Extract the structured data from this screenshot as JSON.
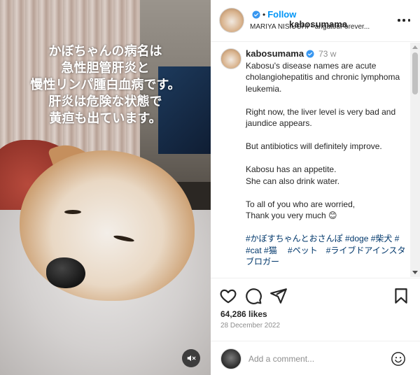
{
  "media": {
    "overlay_lines": [
      "かぼちゃんの病名は",
      "急性胆管肝炎と",
      "慢性リンパ腫白血病です。",
      "肝炎は危険な状態で",
      "黄疸も出ています。"
    ],
    "mute_icon": "speaker-muted-icon"
  },
  "header": {
    "username": "kabosumama",
    "follow_label": "Follow",
    "dot": "•",
    "audio": "MARIYA NISIUCHI • arigatouForever..."
  },
  "caption": {
    "username": "kabosumama",
    "time": "73 w",
    "paragraphs": [
      [
        "Kabosu's disease names are acute cholangiohepatitis and chronic lymphoma leukemia."
      ],
      [
        "Right now, the liver level is very bad and jaundice appears."
      ],
      [
        "But antibiotics will definitely improve."
      ],
      [
        "Kabosu has an appetite.",
        "She can also drink water."
      ],
      [
        "To all of you who are worried,",
        "Thank you very much 😊"
      ]
    ],
    "tags": "#かぼすちゃんとおさんぽ #doge #柴犬 # #cat #猫 　#ペット　#ライブドアインスタブロガー"
  },
  "actions": {
    "likes": "64,286 likes",
    "date": "28 December 2022",
    "icons": [
      "heart-icon",
      "comment-icon",
      "share-icon",
      "bookmark-icon"
    ]
  },
  "comment": {
    "placeholder": "Add a comment...",
    "emoji_icon": "emoji-icon"
  },
  "colors": {
    "accent": "#0095f6",
    "verified": "#3897f0",
    "hashtag": "#00376b",
    "muted_text": "#8e8e8e"
  }
}
